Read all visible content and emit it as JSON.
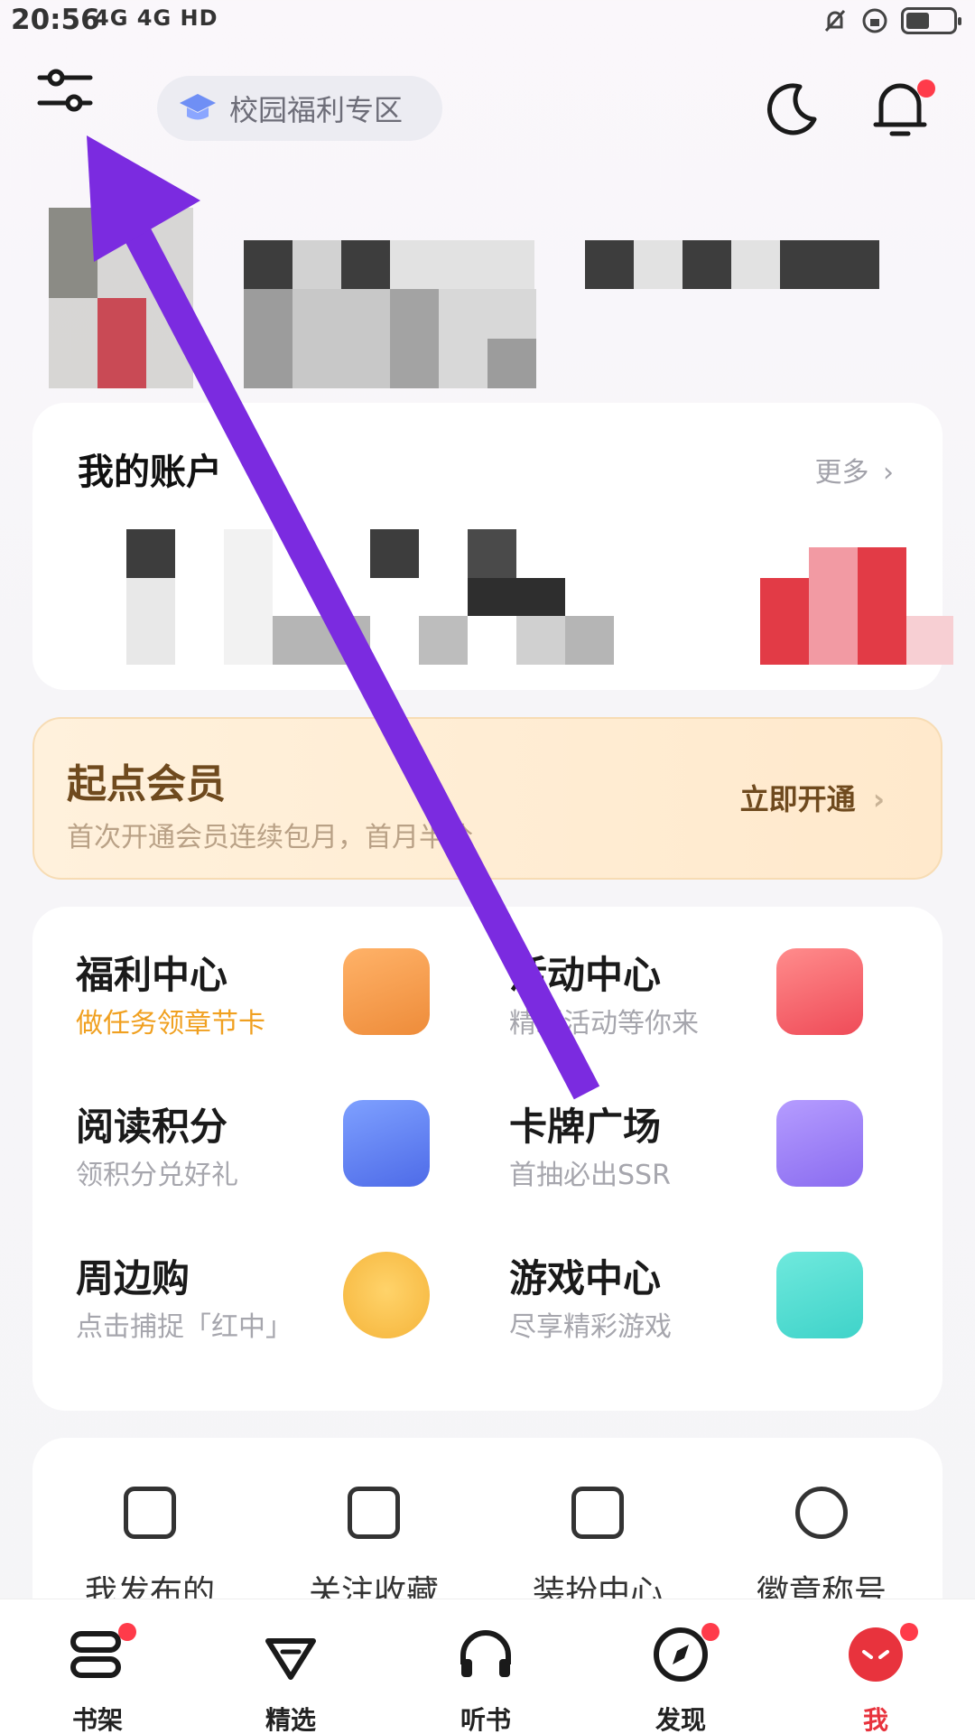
{
  "status_bar": {
    "time": "20:56",
    "signal_text": "4G 4G HD"
  },
  "top_bar": {
    "campus_label": "校园福利专区"
  },
  "account": {
    "title": "我的账户",
    "more": "更多"
  },
  "vip": {
    "title": "起点会员",
    "subtitle": "首次开通会员连续包月，首月半价",
    "cta": "立即开通"
  },
  "grid": [
    {
      "title": "福利中心",
      "subtitle": "做任务领章节卡",
      "color": "#ee8c3a"
    },
    {
      "title": "活动中心",
      "subtitle": "精彩活动等你来",
      "color": "#ef4b58"
    },
    {
      "title": "阅读积分",
      "subtitle": "领积分兑好礼",
      "color": "#4e6be8"
    },
    {
      "title": "卡牌广场",
      "subtitle": "首抽必出SSR",
      "color": "#8a6cf0"
    },
    {
      "title": "周边购",
      "subtitle": "点击捕捉「红中」",
      "color": "#f5b43a"
    },
    {
      "title": "游戏中心",
      "subtitle": "尽享精彩游戏",
      "color": "#3fd3c9"
    }
  ],
  "tools": [
    {
      "label": "我发布的"
    },
    {
      "label": "关注收藏"
    },
    {
      "label": "装扮中心"
    },
    {
      "label": "徽章称号"
    }
  ],
  "nav": [
    {
      "label": "书架"
    },
    {
      "label": "精选"
    },
    {
      "label": "听书"
    },
    {
      "label": "发现"
    },
    {
      "label": "我"
    }
  ],
  "colors": {
    "accent": "#e8333d",
    "overlay_arrow": "#7b2be0",
    "vip_text": "#6f4a1e",
    "welfare_sub": "#f0a020"
  }
}
